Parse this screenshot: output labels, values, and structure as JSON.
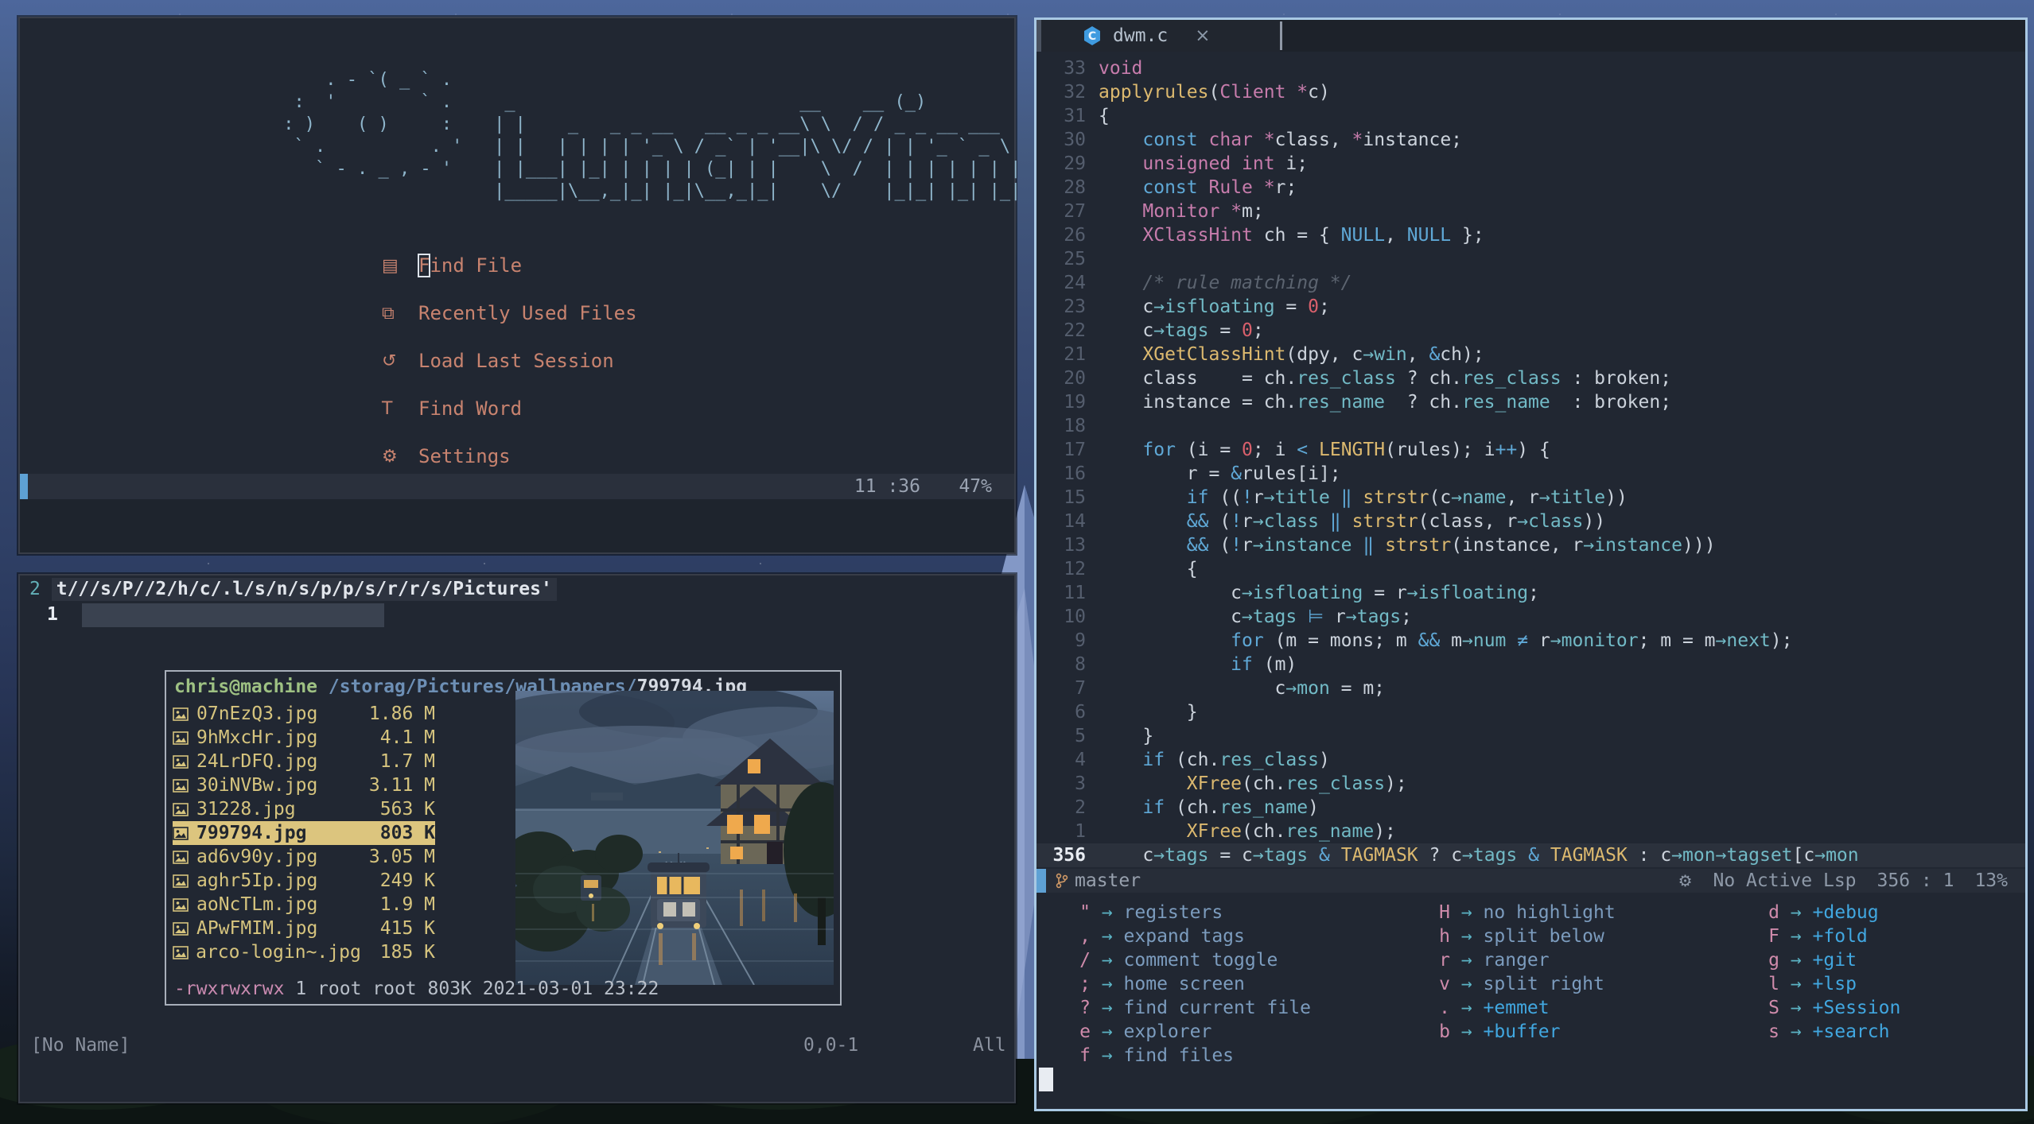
{
  "theme": {
    "desktop_sky": "#4d679c",
    "window_bg": "#212732",
    "accent_blue": "#5ea1d4",
    "menu_salmon": "#c8836f",
    "logo_blue": "#8fb6cc",
    "file_yellow": "#d6c47e",
    "selected_bg": "#dcc57e",
    "user_green": "#9ec183",
    "path_blue": "#6d8fb5",
    "perm_pink": "#c98ab0",
    "keyword_blue": "#5fa8d6",
    "type_pink": "#c77cac",
    "func_yellow": "#dcb96f",
    "member_teal": "#72bac6",
    "number_red": "#d9606c",
    "comment_gray": "#5c6470",
    "whichkey_key_pink": "#cf8bab",
    "whichkey_group_blue": "#41a7e0",
    "git_branch_orange": "#d19a66",
    "focus_border": "#a9c9e4"
  },
  "dashboard": {
    "art": [
      "     . - `( _ ` .",
      "  :  '        ` .     _                           __    __ (_)",
      " : )    ( )     :    | |    _   _ _ __   __ _ _ __\\ \\  / / _ _ __ ___",
      "  ` .          . '   | |   | | | | '_ \\ / _` | '__|\\ \\/ / | | '_ ` _ \\",
      "    ` - . _ , - '    | |___| |_| | | | | (_| | |    \\  /  | | | | | | |",
      "                     |_____|\\__,_|_| |_|\\__,_|_|    \\/    |_|_| |_| |_|"
    ],
    "menu": [
      {
        "icon": "▤",
        "icon_name": "file-icon",
        "label": "Find File",
        "cursor_on_first_char": true
      },
      {
        "icon": "⧉",
        "icon_name": "copies-icon",
        "label": "Recently Used Files"
      },
      {
        "icon": "↺",
        "icon_name": "history-icon",
        "label": "Load Last Session"
      },
      {
        "icon": "T",
        "icon_name": "letter-t-icon",
        "label": "Find Word"
      },
      {
        "icon": "⚙",
        "icon_name": "gear-icon",
        "label": "Settings"
      }
    ],
    "statusline": {
      "position": "11 :36",
      "percent": "47%"
    }
  },
  "explorer": {
    "cmd_number": "2",
    "cmd_text": "t///s/P//2/h/c/.l/s/n/s/p/p/s/r/r/s/Pictures'",
    "line1_number": "1",
    "popup": {
      "user_host": "chris@machine",
      "path_prefix": " /storag/Pictures/wallpapers/",
      "current_file": "799794.jpg",
      "files": [
        {
          "name": "07nEzQ3.jpg",
          "size": "1.86 M",
          "selected": false
        },
        {
          "name": "9hMxcHr.jpg",
          "size": "4.1 M",
          "selected": false
        },
        {
          "name": "24LrDFQ.jpg",
          "size": "1.7 M",
          "selected": false
        },
        {
          "name": "30iNVBw.jpg",
          "size": "3.11 M",
          "selected": false
        },
        {
          "name": "31228.jpg",
          "size": "563 K",
          "selected": false
        },
        {
          "name": "799794.jpg",
          "size": "803 K",
          "selected": true
        },
        {
          "name": "ad6v90y.jpg",
          "size": "3.05 M",
          "selected": false
        },
        {
          "name": "aghr5Ip.jpg",
          "size": "249 K",
          "selected": false
        },
        {
          "name": "aoNcTLm.jpg",
          "size": "1.9 M",
          "selected": false
        },
        {
          "name": "APwFMIM.jpg",
          "size": "415 K",
          "selected": false
        },
        {
          "name": "arco-login~.jpg",
          "size": "185 K",
          "selected": false
        }
      ],
      "perms": "-rwxrwxrwx",
      "perm_rest": " 1 root root 803K 2021-03-01 23:22"
    },
    "statusline": {
      "left": "[No Name]",
      "position": "0,0-1",
      "scroll": "All"
    }
  },
  "editor": {
    "tab": {
      "title": "dwm.c",
      "close": "×"
    },
    "lines": [
      {
        "n": "33",
        "s": [
          [
            "void",
            "p"
          ]
        ]
      },
      {
        "n": "32",
        "s": [
          [
            "applyrules",
            "y"
          ],
          [
            "(",
            "w"
          ],
          [
            "Client",
            "p"
          ],
          [
            " ",
            "w"
          ],
          [
            "*",
            "p"
          ],
          [
            "c)",
            "w"
          ]
        ]
      },
      {
        "n": "31",
        "s": [
          [
            "{",
            "w"
          ]
        ]
      },
      {
        "n": "30",
        "s": [
          [
            "    ",
            "w"
          ],
          [
            "const",
            "b"
          ],
          [
            " ",
            "w"
          ],
          [
            "char",
            "p"
          ],
          [
            " ",
            "w"
          ],
          [
            "*",
            "p"
          ],
          [
            "class, ",
            "w"
          ],
          [
            "*",
            "p"
          ],
          [
            "instance;",
            "w"
          ]
        ]
      },
      {
        "n": "29",
        "s": [
          [
            "    ",
            "w"
          ],
          [
            "unsigned",
            "p"
          ],
          [
            " ",
            "w"
          ],
          [
            "int",
            "p"
          ],
          [
            " i;",
            "w"
          ]
        ]
      },
      {
        "n": "28",
        "s": [
          [
            "    ",
            "w"
          ],
          [
            "const",
            "b"
          ],
          [
            " ",
            "w"
          ],
          [
            "Rule",
            "p"
          ],
          [
            " ",
            "w"
          ],
          [
            "*",
            "p"
          ],
          [
            "r;",
            "w"
          ]
        ]
      },
      {
        "n": "27",
        "s": [
          [
            "    ",
            "w"
          ],
          [
            "Monitor",
            "p"
          ],
          [
            " ",
            "w"
          ],
          [
            "*",
            "p"
          ],
          [
            "m;",
            "w"
          ]
        ]
      },
      {
        "n": "26",
        "s": [
          [
            "    ",
            "w"
          ],
          [
            "XClassHint",
            "p"
          ],
          [
            " ch = { ",
            "w"
          ],
          [
            "NULL",
            "b"
          ],
          [
            ", ",
            "w"
          ],
          [
            "NULL",
            "b"
          ],
          [
            " };",
            "w"
          ]
        ]
      },
      {
        "n": "25",
        "s": []
      },
      {
        "n": "24",
        "s": [
          [
            "    ",
            "w"
          ],
          [
            "/* rule matching */",
            "c"
          ]
        ]
      },
      {
        "n": "23",
        "s": [
          [
            "    c",
            "w"
          ],
          [
            "→isfloating",
            "t"
          ],
          [
            " = ",
            "w"
          ],
          [
            "0",
            "r"
          ],
          [
            ";",
            "w"
          ]
        ]
      },
      {
        "n": "22",
        "s": [
          [
            "    c",
            "w"
          ],
          [
            "→tags",
            "t"
          ],
          [
            " = ",
            "w"
          ],
          [
            "0",
            "r"
          ],
          [
            ";",
            "w"
          ]
        ]
      },
      {
        "n": "21",
        "s": [
          [
            "    ",
            "w"
          ],
          [
            "XGetClassHint",
            "y"
          ],
          [
            "(dpy, c",
            "w"
          ],
          [
            "→win",
            "t"
          ],
          [
            ", ",
            "w"
          ],
          [
            "&",
            "b"
          ],
          [
            "ch);",
            "w"
          ]
        ]
      },
      {
        "n": "20",
        "s": [
          [
            "    class    = ch.",
            "w"
          ],
          [
            "res_class",
            "t"
          ],
          [
            " ? ch.",
            "w"
          ],
          [
            "res_class",
            "t"
          ],
          [
            " : broken;",
            "w"
          ]
        ]
      },
      {
        "n": "19",
        "s": [
          [
            "    instance = ch.",
            "w"
          ],
          [
            "res_name",
            "t"
          ],
          [
            "  ? ch.",
            "w"
          ],
          [
            "res_name",
            "t"
          ],
          [
            "  : broken;",
            "w"
          ]
        ]
      },
      {
        "n": "18",
        "s": []
      },
      {
        "n": "17",
        "s": [
          [
            "    ",
            "w"
          ],
          [
            "for",
            "b"
          ],
          [
            " (i = ",
            "w"
          ],
          [
            "0",
            "r"
          ],
          [
            "; i ",
            "w"
          ],
          [
            "<",
            "b"
          ],
          [
            " ",
            "w"
          ],
          [
            "LENGTH",
            "y"
          ],
          [
            "(rules); i",
            "w"
          ],
          [
            "++",
            "b"
          ],
          [
            ") {",
            "w"
          ]
        ]
      },
      {
        "n": "16",
        "s": [
          [
            "        r = ",
            "w"
          ],
          [
            "&",
            "b"
          ],
          [
            "rules[i];",
            "w"
          ]
        ]
      },
      {
        "n": "15",
        "s": [
          [
            "        ",
            "w"
          ],
          [
            "if",
            "b"
          ],
          [
            " ((",
            "w"
          ],
          [
            "!",
            "b"
          ],
          [
            "r",
            "w"
          ],
          [
            "→title",
            "t"
          ],
          [
            " ",
            "w"
          ],
          [
            "‖",
            "b"
          ],
          [
            " ",
            "w"
          ],
          [
            "strstr",
            "y"
          ],
          [
            "(c",
            "w"
          ],
          [
            "→name",
            "t"
          ],
          [
            ", r",
            "w"
          ],
          [
            "→title",
            "t"
          ],
          [
            "))",
            "w"
          ]
        ]
      },
      {
        "n": "14",
        "s": [
          [
            "        ",
            "w"
          ],
          [
            "&&",
            "b"
          ],
          [
            " (",
            "w"
          ],
          [
            "!",
            "b"
          ],
          [
            "r",
            "w"
          ],
          [
            "→class",
            "t"
          ],
          [
            " ",
            "w"
          ],
          [
            "‖",
            "b"
          ],
          [
            " ",
            "w"
          ],
          [
            "strstr",
            "y"
          ],
          [
            "(class, r",
            "w"
          ],
          [
            "→class",
            "t"
          ],
          [
            "))",
            "w"
          ]
        ]
      },
      {
        "n": "13",
        "s": [
          [
            "        ",
            "w"
          ],
          [
            "&&",
            "b"
          ],
          [
            " (",
            "w"
          ],
          [
            "!",
            "b"
          ],
          [
            "r",
            "w"
          ],
          [
            "→instance",
            "t"
          ],
          [
            " ",
            "w"
          ],
          [
            "‖",
            "b"
          ],
          [
            " ",
            "w"
          ],
          [
            "strstr",
            "y"
          ],
          [
            "(instance, r",
            "w"
          ],
          [
            "→instance",
            "t"
          ],
          [
            ")))",
            "w"
          ]
        ]
      },
      {
        "n": "12",
        "s": [
          [
            "        {",
            "w"
          ]
        ]
      },
      {
        "n": "11",
        "s": [
          [
            "            c",
            "w"
          ],
          [
            "→isfloating",
            "t"
          ],
          [
            " = r",
            "w"
          ],
          [
            "→isfloating",
            "t"
          ],
          [
            ";",
            "w"
          ]
        ]
      },
      {
        "n": "10",
        "s": [
          [
            "            c",
            "w"
          ],
          [
            "→tags",
            "t"
          ],
          [
            " ",
            "w"
          ],
          [
            "⊨",
            "b"
          ],
          [
            " r",
            "w"
          ],
          [
            "→tags",
            "t"
          ],
          [
            ";",
            "w"
          ]
        ]
      },
      {
        "n": "9",
        "s": [
          [
            "            ",
            "w"
          ],
          [
            "for",
            "b"
          ],
          [
            " (m = mons; m ",
            "w"
          ],
          [
            "&&",
            "b"
          ],
          [
            " m",
            "w"
          ],
          [
            "→num",
            "t"
          ],
          [
            " ",
            "w"
          ],
          [
            "≠",
            "b"
          ],
          [
            " r",
            "w"
          ],
          [
            "→monitor",
            "t"
          ],
          [
            "; m = m",
            "w"
          ],
          [
            "→next",
            "t"
          ],
          [
            ");",
            "w"
          ]
        ]
      },
      {
        "n": "8",
        "s": [
          [
            "            ",
            "w"
          ],
          [
            "if",
            "b"
          ],
          [
            " (m)",
            "w"
          ]
        ]
      },
      {
        "n": "7",
        "s": [
          [
            "                c",
            "w"
          ],
          [
            "→mon",
            "t"
          ],
          [
            " = m;",
            "w"
          ]
        ]
      },
      {
        "n": "6",
        "s": [
          [
            "        }",
            "w"
          ]
        ]
      },
      {
        "n": "5",
        "s": [
          [
            "    }",
            "w"
          ]
        ]
      },
      {
        "n": "4",
        "s": [
          [
            "    ",
            "w"
          ],
          [
            "if",
            "b"
          ],
          [
            " (ch.",
            "w"
          ],
          [
            "res_class",
            "t"
          ],
          [
            ")",
            "w"
          ]
        ]
      },
      {
        "n": "3",
        "s": [
          [
            "        ",
            "w"
          ],
          [
            "XFree",
            "y"
          ],
          [
            "(ch.",
            "w"
          ],
          [
            "res_class",
            "t"
          ],
          [
            ");",
            "w"
          ]
        ]
      },
      {
        "n": "2",
        "s": [
          [
            "    ",
            "w"
          ],
          [
            "if",
            "b"
          ],
          [
            " (ch.",
            "w"
          ],
          [
            "res_name",
            "t"
          ],
          [
            ")",
            "w"
          ]
        ]
      },
      {
        "n": "1",
        "s": [
          [
            "        ",
            "w"
          ],
          [
            "XFree",
            "y"
          ],
          [
            "(ch.",
            "w"
          ],
          [
            "res_name",
            "t"
          ],
          [
            ");",
            "w"
          ]
        ]
      },
      {
        "n": "356",
        "cur": true,
        "s": [
          [
            "    c",
            "w"
          ],
          [
            "→tags",
            "t"
          ],
          [
            " = c",
            "w"
          ],
          [
            "→tags",
            "t"
          ],
          [
            " ",
            "w"
          ],
          [
            "&",
            "b"
          ],
          [
            " ",
            "w"
          ],
          [
            "TAGMASK",
            "y"
          ],
          [
            " ? c",
            "w"
          ],
          [
            "→tags",
            "t"
          ],
          [
            " ",
            "w"
          ],
          [
            "&",
            "b"
          ],
          [
            " ",
            "w"
          ],
          [
            "TAGMASK",
            "y"
          ],
          [
            " : c",
            "w"
          ],
          [
            "→mon",
            "t"
          ],
          [
            "→tagset",
            "t"
          ],
          [
            "[c",
            "w"
          ],
          [
            "→mon",
            "t"
          ]
        ]
      }
    ],
    "statusline": {
      "branch": "master",
      "gear": "⚙",
      "lsp": "No Active Lsp",
      "line_col": "356 : 1",
      "percent": "13%"
    },
    "whichkey": {
      "arrow": "→",
      "columns": [
        [
          {
            "k": "\"",
            "d": "registers"
          },
          {
            "k": ",",
            "d": "expand tags"
          },
          {
            "k": "/",
            "d": "comment toggle"
          },
          {
            "k": ";",
            "d": "home screen"
          },
          {
            "k": "?",
            "d": "find current file"
          },
          {
            "k": "e",
            "d": "explorer"
          },
          {
            "k": "f",
            "d": "find files"
          }
        ],
        [
          {
            "k": "H",
            "d": "no highlight"
          },
          {
            "k": "h",
            "d": "split below"
          },
          {
            "k": "r",
            "d": "ranger"
          },
          {
            "k": "v",
            "d": "split right"
          },
          {
            "k": ".",
            "d": "+emmet"
          },
          {
            "k": "b",
            "d": "+buffer"
          }
        ],
        [
          {
            "k": "d",
            "d": "+debug"
          },
          {
            "k": "F",
            "d": "+fold"
          },
          {
            "k": "g",
            "d": "+git"
          },
          {
            "k": "l",
            "d": "+lsp"
          },
          {
            "k": "S",
            "d": "+Session"
          },
          {
            "k": "s",
            "d": "+search"
          }
        ]
      ]
    }
  }
}
